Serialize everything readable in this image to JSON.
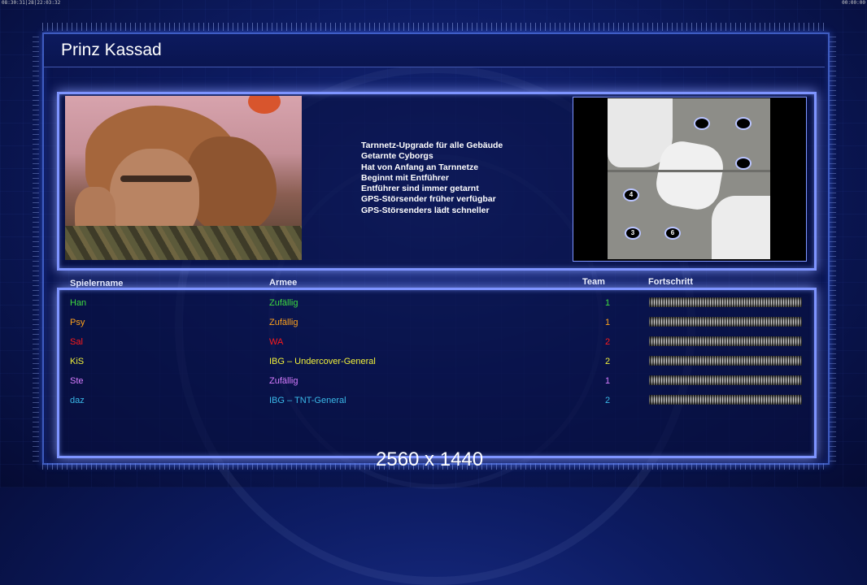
{
  "clock": {
    "left": "08:30:31|28|22:03:32",
    "right": "00:00:00"
  },
  "general": {
    "name": "Prinz Kassad"
  },
  "abilities": [
    "Tarnnetz-Upgrade für alle Gebäude",
    "Getarnte Cyborgs",
    "Hat von Anfang an Tarnnetze",
    "Beginnt mit Entführer",
    "Entführer sind immer getarnt",
    "GPS-Störsender früher verfügbar",
    "GPS-Störsenders lädt schneller"
  ],
  "map": {
    "start_positions": [
      "4",
      "3",
      "6"
    ]
  },
  "table": {
    "headers": {
      "player": "Spielername",
      "army": "Armee",
      "team": "Team",
      "progress": "Fortschritt"
    },
    "rows": [
      {
        "name": "Han",
        "army": "Zufällig",
        "team": "1",
        "color": "#3fdc3f",
        "progress": 1.0
      },
      {
        "name": "Psy",
        "army": "Zufällig",
        "team": "1",
        "color": "#ffa21a",
        "progress": 1.0
      },
      {
        "name": "Sal",
        "army": "WA",
        "team": "2",
        "color": "#ff1a1a",
        "progress": 1.0
      },
      {
        "name": "KiS",
        "army": "IBG – Undercover-General",
        "team": "2",
        "color": "#f0f03a",
        "progress": 1.0
      },
      {
        "name": "Ste",
        "army": "Zufällig",
        "team": "1",
        "color": "#d77cff",
        "progress": 1.0
      },
      {
        "name": "daz",
        "army": "IBG – TNT-General",
        "team": "2",
        "color": "#3ab8e8",
        "progress": 1.0
      }
    ]
  },
  "resolution_label": "2560 x 1440"
}
